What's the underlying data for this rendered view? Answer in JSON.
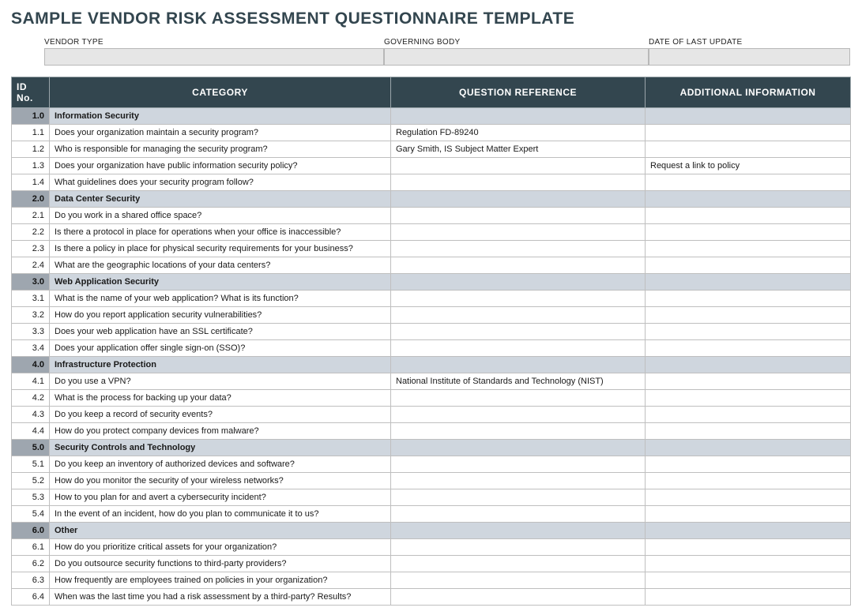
{
  "title": "SAMPLE VENDOR RISK ASSESSMENT QUESTIONNAIRE TEMPLATE",
  "meta": {
    "vendor_type_label": "VENDOR TYPE",
    "vendor_type_value": "",
    "governing_body_label": "GOVERNING BODY",
    "governing_body_value": "",
    "date_label": "DATE OF LAST UPDATE",
    "date_value": ""
  },
  "columns": {
    "id": "ID No.",
    "category": "CATEGORY",
    "reference": "QUESTION REFERENCE",
    "info": "ADDITIONAL INFORMATION"
  },
  "rows": [
    {
      "type": "section",
      "id": "1.0",
      "category": "Information Security",
      "reference": "",
      "info": ""
    },
    {
      "type": "item",
      "id": "1.1",
      "category": "Does your organization maintain a security program?",
      "reference": "Regulation FD-89240",
      "info": ""
    },
    {
      "type": "item",
      "id": "1.2",
      "category": "Who is responsible for managing the security program?",
      "reference": "Gary Smith, IS Subject Matter Expert",
      "info": ""
    },
    {
      "type": "item",
      "id": "1.3",
      "category": "Does your organization have public information security policy?",
      "reference": "",
      "info": "Request a link to policy"
    },
    {
      "type": "item",
      "id": "1.4",
      "category": "What guidelines does your security program follow?",
      "reference": "",
      "info": ""
    },
    {
      "type": "section",
      "id": "2.0",
      "category": "Data Center Security",
      "reference": "",
      "info": ""
    },
    {
      "type": "item",
      "id": "2.1",
      "category": "Do you work in a shared office space?",
      "reference": "",
      "info": ""
    },
    {
      "type": "item",
      "id": "2.2",
      "category": "Is there a protocol in place for operations when your office is inaccessible?",
      "reference": "",
      "info": ""
    },
    {
      "type": "item",
      "id": "2.3",
      "category": "Is there a policy in place for physical security requirements for your business?",
      "reference": "",
      "info": ""
    },
    {
      "type": "item",
      "id": "2.4",
      "category": "What are the geographic locations of your data centers?",
      "reference": "",
      "info": ""
    },
    {
      "type": "section",
      "id": "3.0",
      "category": "Web Application Security",
      "reference": "",
      "info": ""
    },
    {
      "type": "item",
      "id": "3.1",
      "category": "What is the name of your web application? What is its function?",
      "reference": "",
      "info": ""
    },
    {
      "type": "item",
      "id": "3.2",
      "category": "How do you report application security vulnerabilities?",
      "reference": "",
      "info": ""
    },
    {
      "type": "item",
      "id": "3.3",
      "category": "Does your web application have an SSL certificate?",
      "reference": "",
      "info": ""
    },
    {
      "type": "item",
      "id": "3.4",
      "category": "Does your application offer single sign-on (SSO)?",
      "reference": "",
      "info": ""
    },
    {
      "type": "section",
      "id": "4.0",
      "category": "Infrastructure Protection",
      "reference": "",
      "info": ""
    },
    {
      "type": "item",
      "id": "4.1",
      "category": "Do you use a VPN?",
      "reference": "National Institute of Standards and Technology (NIST)",
      "info": ""
    },
    {
      "type": "item",
      "id": "4.2",
      "category": "What is the process for backing up your data?",
      "reference": "",
      "info": ""
    },
    {
      "type": "item",
      "id": "4.3",
      "category": "Do you keep a record of security events?",
      "reference": "",
      "info": ""
    },
    {
      "type": "item",
      "id": "4.4",
      "category": "How do you protect company devices from malware?",
      "reference": "",
      "info": ""
    },
    {
      "type": "section",
      "id": "5.0",
      "category": "Security Controls and Technology",
      "reference": "",
      "info": ""
    },
    {
      "type": "item",
      "id": "5.1",
      "category": "Do you keep an inventory of authorized devices and software?",
      "reference": "",
      "info": ""
    },
    {
      "type": "item",
      "id": "5.2",
      "category": "How do you monitor the security of your wireless networks?",
      "reference": "",
      "info": ""
    },
    {
      "type": "item",
      "id": "5.3",
      "category": "How to you plan for and avert a cybersecurity incident?",
      "reference": "",
      "info": ""
    },
    {
      "type": "item",
      "id": "5.4",
      "category": "In the event of an incident, how do you plan to communicate it to us?",
      "reference": "",
      "info": ""
    },
    {
      "type": "section",
      "id": "6.0",
      "category": "Other",
      "reference": "",
      "info": ""
    },
    {
      "type": "item",
      "id": "6.1",
      "category": "How do you prioritize critical assets for your organization?",
      "reference": "",
      "info": ""
    },
    {
      "type": "item",
      "id": "6.2",
      "category": "Do you outsource security functions to third-party providers?",
      "reference": "",
      "info": ""
    },
    {
      "type": "item",
      "id": "6.3",
      "category": "How frequently are employees trained on policies in your organization?",
      "reference": "",
      "info": ""
    },
    {
      "type": "item",
      "id": "6.4",
      "category": "When was the last time you had a risk assessment by a third-party? Results?",
      "reference": "",
      "info": ""
    }
  ]
}
